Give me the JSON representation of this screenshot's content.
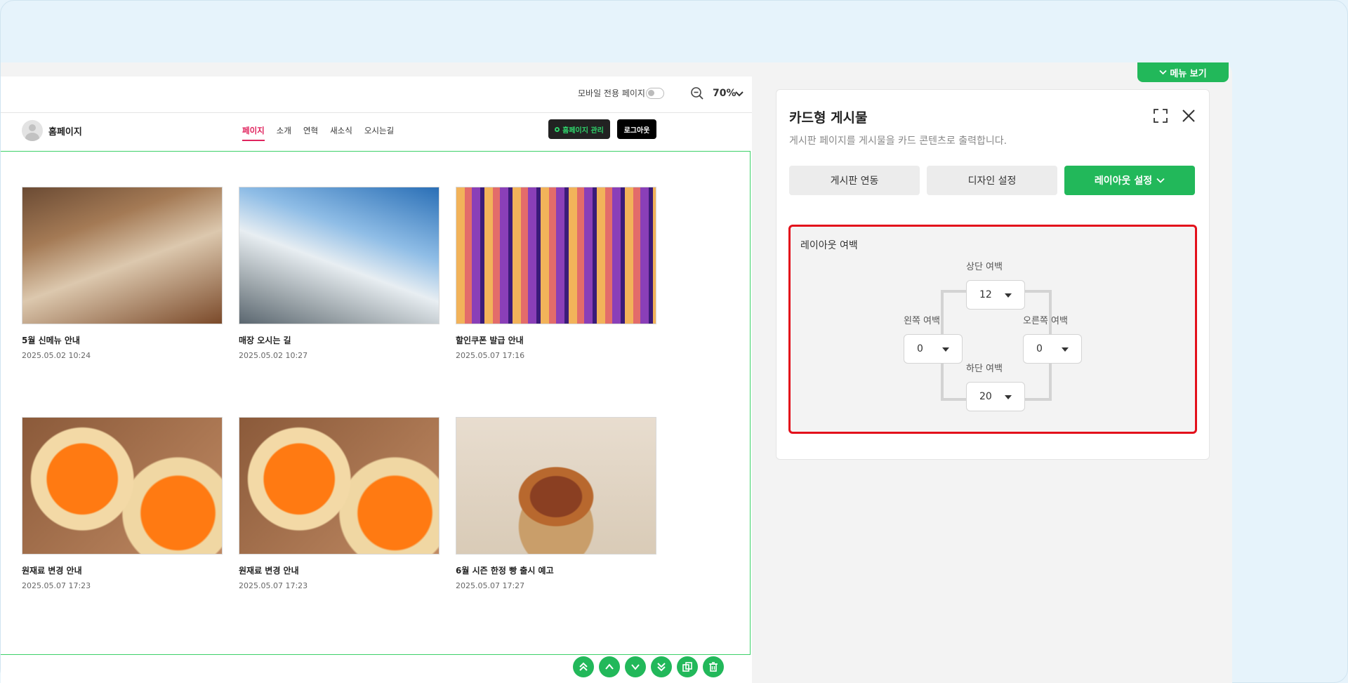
{
  "preview": {
    "mobile_only_label": "모바일 전용 페이지",
    "zoom_level": "70%"
  },
  "site": {
    "name": "홈페이지",
    "nav": [
      "페이지",
      "소개",
      "연혁",
      "새소식",
      "오시는길"
    ],
    "active_nav": "페이지",
    "admin_button": "홈페이지 관리",
    "logout_button": "로그아웃"
  },
  "board": {
    "cards": [
      {
        "title": "5월 신메뉴 안내",
        "date": "2025.05.02 10:24",
        "image": "bread"
      },
      {
        "title": "매장 오시는 길",
        "date": "2025.05.02 10:27",
        "image": "building"
      },
      {
        "title": "할인쿠폰 발급 안내",
        "date": "2025.05.07 17:16",
        "image": "neon"
      },
      {
        "title": "원재료 변경 안내",
        "date": "2025.05.07 17:23",
        "image": "jam"
      },
      {
        "title": "원재료 변경 안내",
        "date": "2025.05.07 17:23",
        "image": "jam"
      },
      {
        "title": "6월 시즌 한정 빵 출시 예고",
        "date": "2025.05.07 17:27",
        "image": "croissant"
      }
    ],
    "actions": [
      "move-top-icon",
      "move-up-icon",
      "move-down-icon",
      "move-bottom-icon",
      "copy-icon",
      "delete-icon"
    ]
  },
  "panel": {
    "menu_toggle": "메뉴 보기",
    "title": "카드형 게시물",
    "description": "게시판 페이지를 게시물을 카드 콘텐츠로 출력합니다.",
    "tabs": [
      {
        "label": "게시판 연동",
        "active": false
      },
      {
        "label": "디자인 설정",
        "active": false
      },
      {
        "label": "레이아웃 설정",
        "active": true
      }
    ],
    "layout_margin": {
      "title": "레이아웃 여백",
      "top_label": "상단 여백",
      "top_value": "12",
      "left_label": "왼쪽 여백",
      "left_value": "0",
      "right_label": "오른쪽 여백",
      "right_value": "0",
      "bottom_label": "하단 여백",
      "bottom_value": "20"
    }
  },
  "colors": {
    "accent_green": "#22b85a",
    "frame_green": "#3dd169",
    "highlight_red": "#e3101b",
    "nav_active": "#e0245e"
  }
}
